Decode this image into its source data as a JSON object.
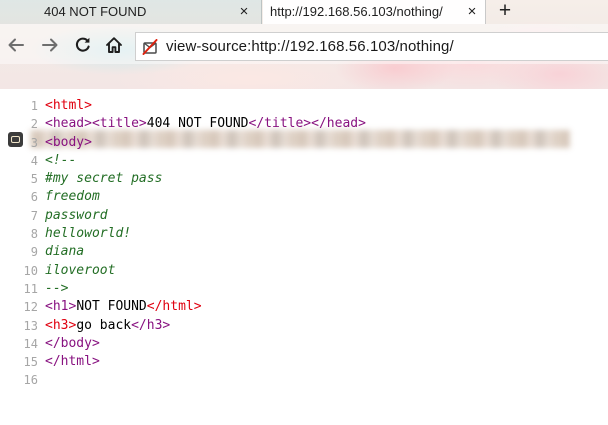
{
  "tabs": [
    {
      "title": "404 NOT FOUND",
      "active": false
    },
    {
      "title": "http://192.168.56.103/nothing/",
      "active": true
    }
  ],
  "address_bar": {
    "url": "view-source:http://192.168.56.103/nothing/"
  },
  "icons": {
    "close": "×",
    "new_tab": "+"
  },
  "colors": {
    "tag": "#881280",
    "tag_error": "#e0000f",
    "comment": "#236e25",
    "line_number": "#a6a6a6"
  },
  "source": {
    "lines": [
      {
        "num": "1",
        "parts": [
          {
            "t": "<html>",
            "c": "tag-err"
          }
        ]
      },
      {
        "num": "2",
        "parts": [
          {
            "t": "<head>",
            "c": "tag"
          },
          {
            "t": "<title>",
            "c": "tag"
          },
          {
            "t": "404 NOT FOUND",
            "c": "text"
          },
          {
            "t": "</title>",
            "c": "tag"
          },
          {
            "t": "</head>",
            "c": "tag"
          }
        ]
      },
      {
        "num": "3",
        "parts": [
          {
            "t": "<body>",
            "c": "tag"
          }
        ]
      },
      {
        "num": "4",
        "parts": [
          {
            "t": "<!--",
            "c": "cmt"
          }
        ]
      },
      {
        "num": "5",
        "parts": [
          {
            "t": "#my secret pass",
            "c": "cmt"
          }
        ]
      },
      {
        "num": "6",
        "parts": [
          {
            "t": "freedom",
            "c": "cmt"
          }
        ]
      },
      {
        "num": "7",
        "parts": [
          {
            "t": "password",
            "c": "cmt"
          }
        ]
      },
      {
        "num": "8",
        "parts": [
          {
            "t": "helloworld!",
            "c": "cmt"
          }
        ]
      },
      {
        "num": "9",
        "parts": [
          {
            "t": "diana",
            "c": "cmt"
          }
        ]
      },
      {
        "num": "10",
        "parts": [
          {
            "t": "iloveroot",
            "c": "cmt"
          }
        ]
      },
      {
        "num": "11",
        "parts": [
          {
            "t": "-->",
            "c": "cmt"
          }
        ]
      },
      {
        "num": "12",
        "parts": [
          {
            "t": "<h1>",
            "c": "tag"
          },
          {
            "t": "NOT FOUND",
            "c": "text"
          },
          {
            "t": "</html>",
            "c": "tag-err"
          }
        ]
      },
      {
        "num": "13",
        "parts": [
          {
            "t": "<h3>",
            "c": "tag-err"
          },
          {
            "t": "go back",
            "c": "text"
          },
          {
            "t": "</h3>",
            "c": "tag"
          }
        ]
      },
      {
        "num": "14",
        "parts": [
          {
            "t": "</body>",
            "c": "tag"
          }
        ]
      },
      {
        "num": "15",
        "parts": [
          {
            "t": "</html>",
            "c": "tag"
          }
        ]
      },
      {
        "num": "16",
        "parts": []
      }
    ]
  }
}
